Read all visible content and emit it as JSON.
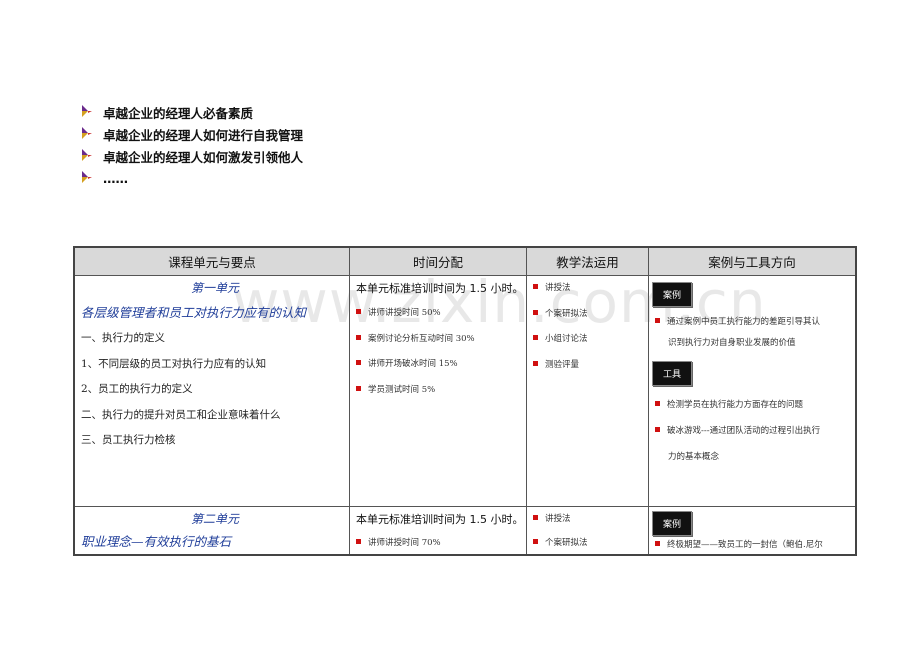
{
  "bullets": [
    "卓越企业的经理人必备素质",
    "卓越企业的经理人如何进行自我管理",
    "卓越企业的经理人如何激发引领他人",
    "……"
  ],
  "watermark": "www.zixin.com.cn",
  "table": {
    "headers": [
      "课程单元与要点",
      "时间分配",
      "教学法运用",
      "案例与工具方向"
    ],
    "unit1": {
      "title": "第一单元",
      "subtitle": "各层级管理者和员工对执行力应有的认知",
      "points": [
        "一、执行力的定义",
        "1、不同层级的员工对执行力应有的认知",
        "2、员工的执行力的定义",
        "二、执行力的提升对员工和企业意味着什么",
        "三、员工执行力检核"
      ],
      "time_head": "本单元标准培训时间为 1.5 小时。",
      "time_items": [
        "讲师讲授时间 50%",
        "案例讨论分析互动时间 30%",
        "讲师开场破冰时间 15%",
        "学员测试时间 5%"
      ],
      "methods": [
        "讲授法",
        "个案研拟法",
        "小组讨论法",
        "测验评量"
      ],
      "case_label": "案例",
      "case_item_line1": "通过案例中员工执行能力的差距引导其认",
      "case_item_line2": "识到执行力对自身职业发展的价值",
      "tool_label": "工具",
      "tool_item1": "检测学员在执行能力方面存在的问题",
      "tool_item2_line1": "破冰游戏---通过团队活动的过程引出执行",
      "tool_item2_line2": "力的基本概念"
    },
    "unit2": {
      "title": "第二单元",
      "subtitle": "职业理念—有效执行的基石",
      "time_head": "本单元标准培训时间为 1.5 小时。",
      "time_items": [
        "讲师讲授时间 70%"
      ],
      "methods": [
        "讲授法",
        "个案研拟法"
      ],
      "case_label": "案例",
      "case_item": "终极期望——致员工的一封信（鲍伯.尼尔"
    }
  },
  "colors": {
    "accent_blue": "#1f3d99",
    "bullet_red": "#d01010",
    "header_gray": "#d9d9d9"
  }
}
